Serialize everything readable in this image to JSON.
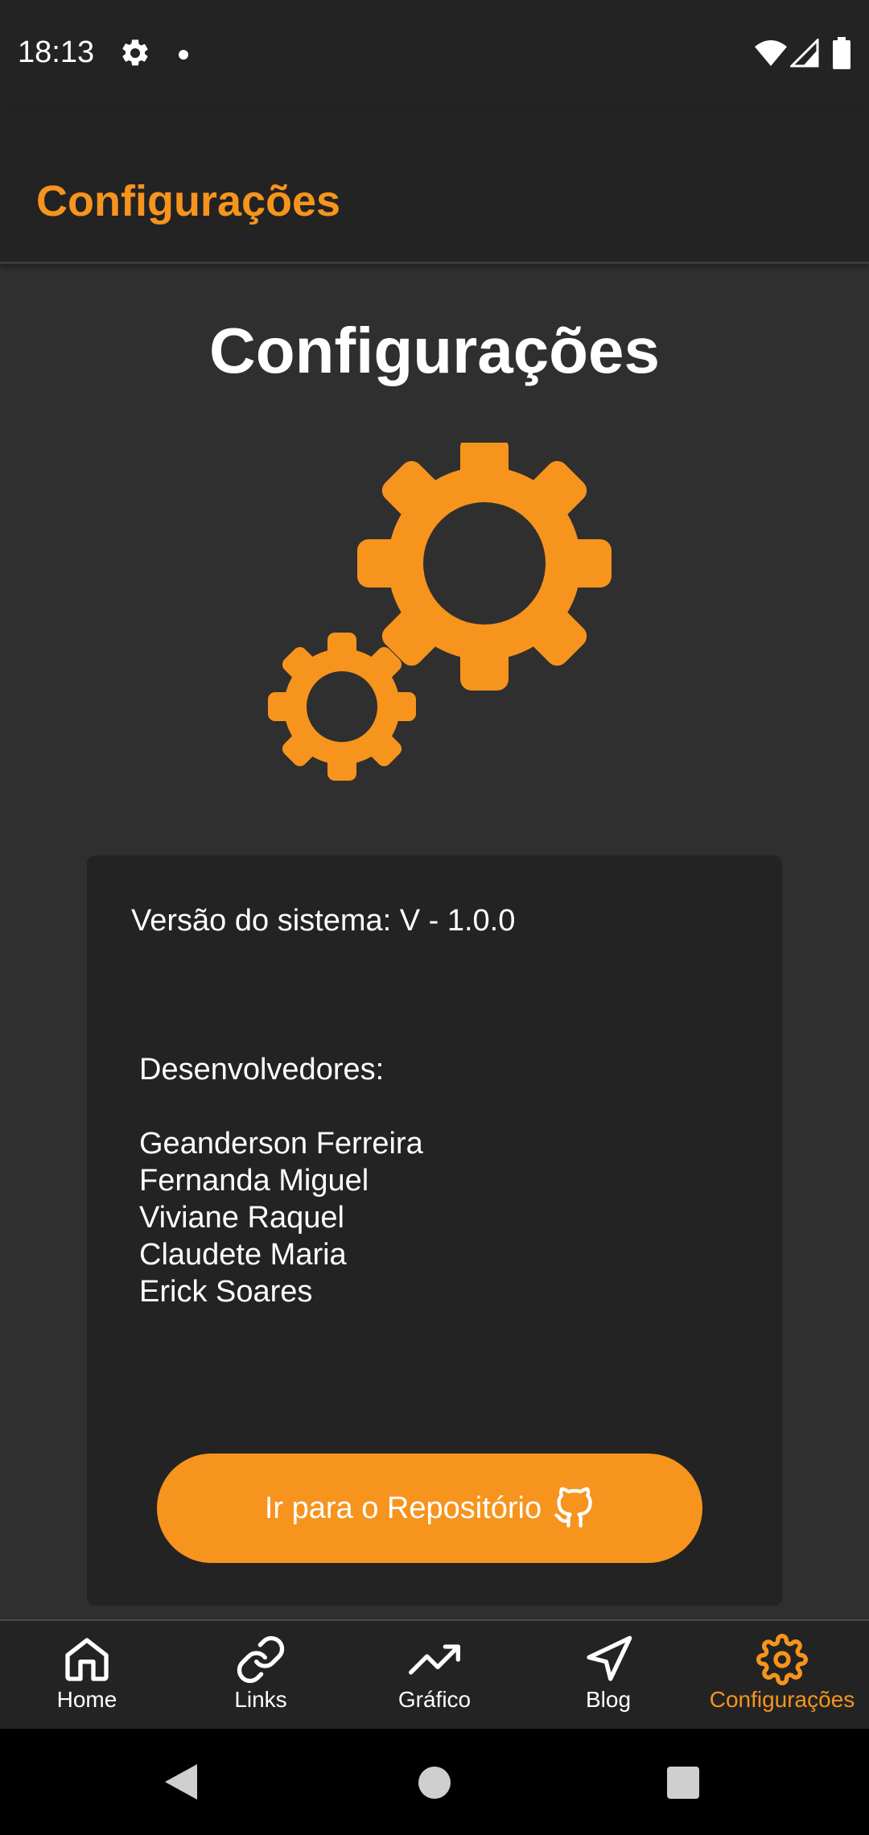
{
  "status_bar": {
    "time": "18:13",
    "icons": [
      "settings-icon",
      "notification-dot-icon",
      "wifi-icon",
      "signal-icon",
      "battery-icon"
    ]
  },
  "app_bar": {
    "title": "Configurações"
  },
  "page": {
    "heading": "Configurações",
    "illustration": "gears-icon"
  },
  "card": {
    "version_text": "Versão do sistema: V - 1.0.0",
    "developers_title": "Desenvolvedores:",
    "developers": [
      "Geanderson Ferreira",
      "Fernanda Miguel",
      "Viviane Raquel",
      "Claudete Maria",
      "Erick Soares"
    ],
    "repo_button": {
      "label": "Ir para o Repositório",
      "icon": "github-icon"
    }
  },
  "bottom_nav": {
    "items": [
      {
        "label": "Home",
        "icon": "home-icon",
        "active": false
      },
      {
        "label": "Links",
        "icon": "link-icon",
        "active": false
      },
      {
        "label": "Gráfico",
        "icon": "trending-up-icon",
        "active": false
      },
      {
        "label": "Blog",
        "icon": "navigation-icon",
        "active": false
      },
      {
        "label": "Configurações",
        "icon": "settings-icon",
        "active": true
      }
    ]
  },
  "colors": {
    "accent": "#f7941d",
    "background": "#2f2f2f",
    "surface": "#232323",
    "text": "#ffffff"
  }
}
